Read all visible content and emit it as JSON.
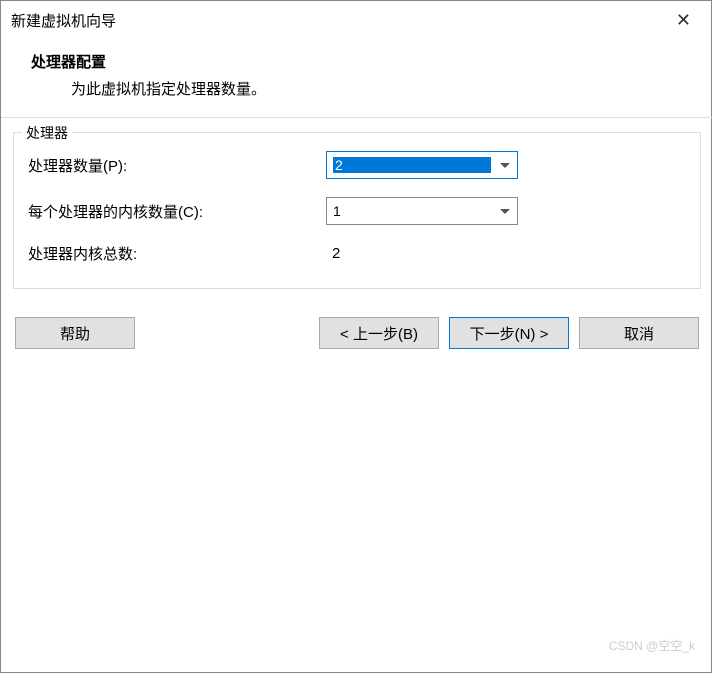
{
  "titlebar": {
    "title": "新建虚拟机向导"
  },
  "header": {
    "title": "处理器配置",
    "subtitle": "为此虚拟机指定处理器数量。"
  },
  "fieldset": {
    "legend": "处理器",
    "rows": {
      "procCount": {
        "label": "处理器数量(P):",
        "value": "2"
      },
      "coresPerProc": {
        "label": "每个处理器的内核数量(C):",
        "value": "1"
      },
      "totalCores": {
        "label": "处理器内核总数:",
        "value": "2"
      }
    }
  },
  "buttons": {
    "help": "帮助",
    "back": "< 上一步(B)",
    "next": "下一步(N) >",
    "cancel": "取消"
  },
  "watermark": "CSDN @空空_k"
}
